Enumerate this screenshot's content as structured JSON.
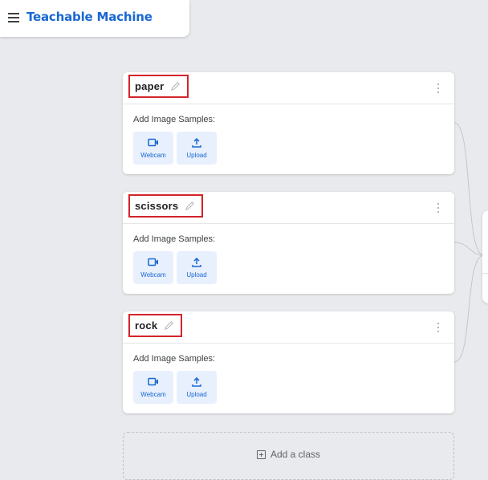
{
  "header": {
    "app_title": "Teachable Machine"
  },
  "classes": [
    {
      "name": "paper",
      "samples_label": "Add Image Samples:",
      "webcam_label": "Webcam",
      "upload_label": "Upload"
    },
    {
      "name": "scissors",
      "samples_label": "Add Image Samples:",
      "webcam_label": "Webcam",
      "upload_label": "Upload"
    },
    {
      "name": "rock",
      "samples_label": "Add Image Samples:",
      "webcam_label": "Webcam",
      "upload_label": "Upload"
    }
  ],
  "add_class": {
    "label": "Add a class"
  },
  "colors": {
    "brand": "#1967d2",
    "highlight": "#d3242a",
    "button_bg": "#e8f0fe"
  }
}
